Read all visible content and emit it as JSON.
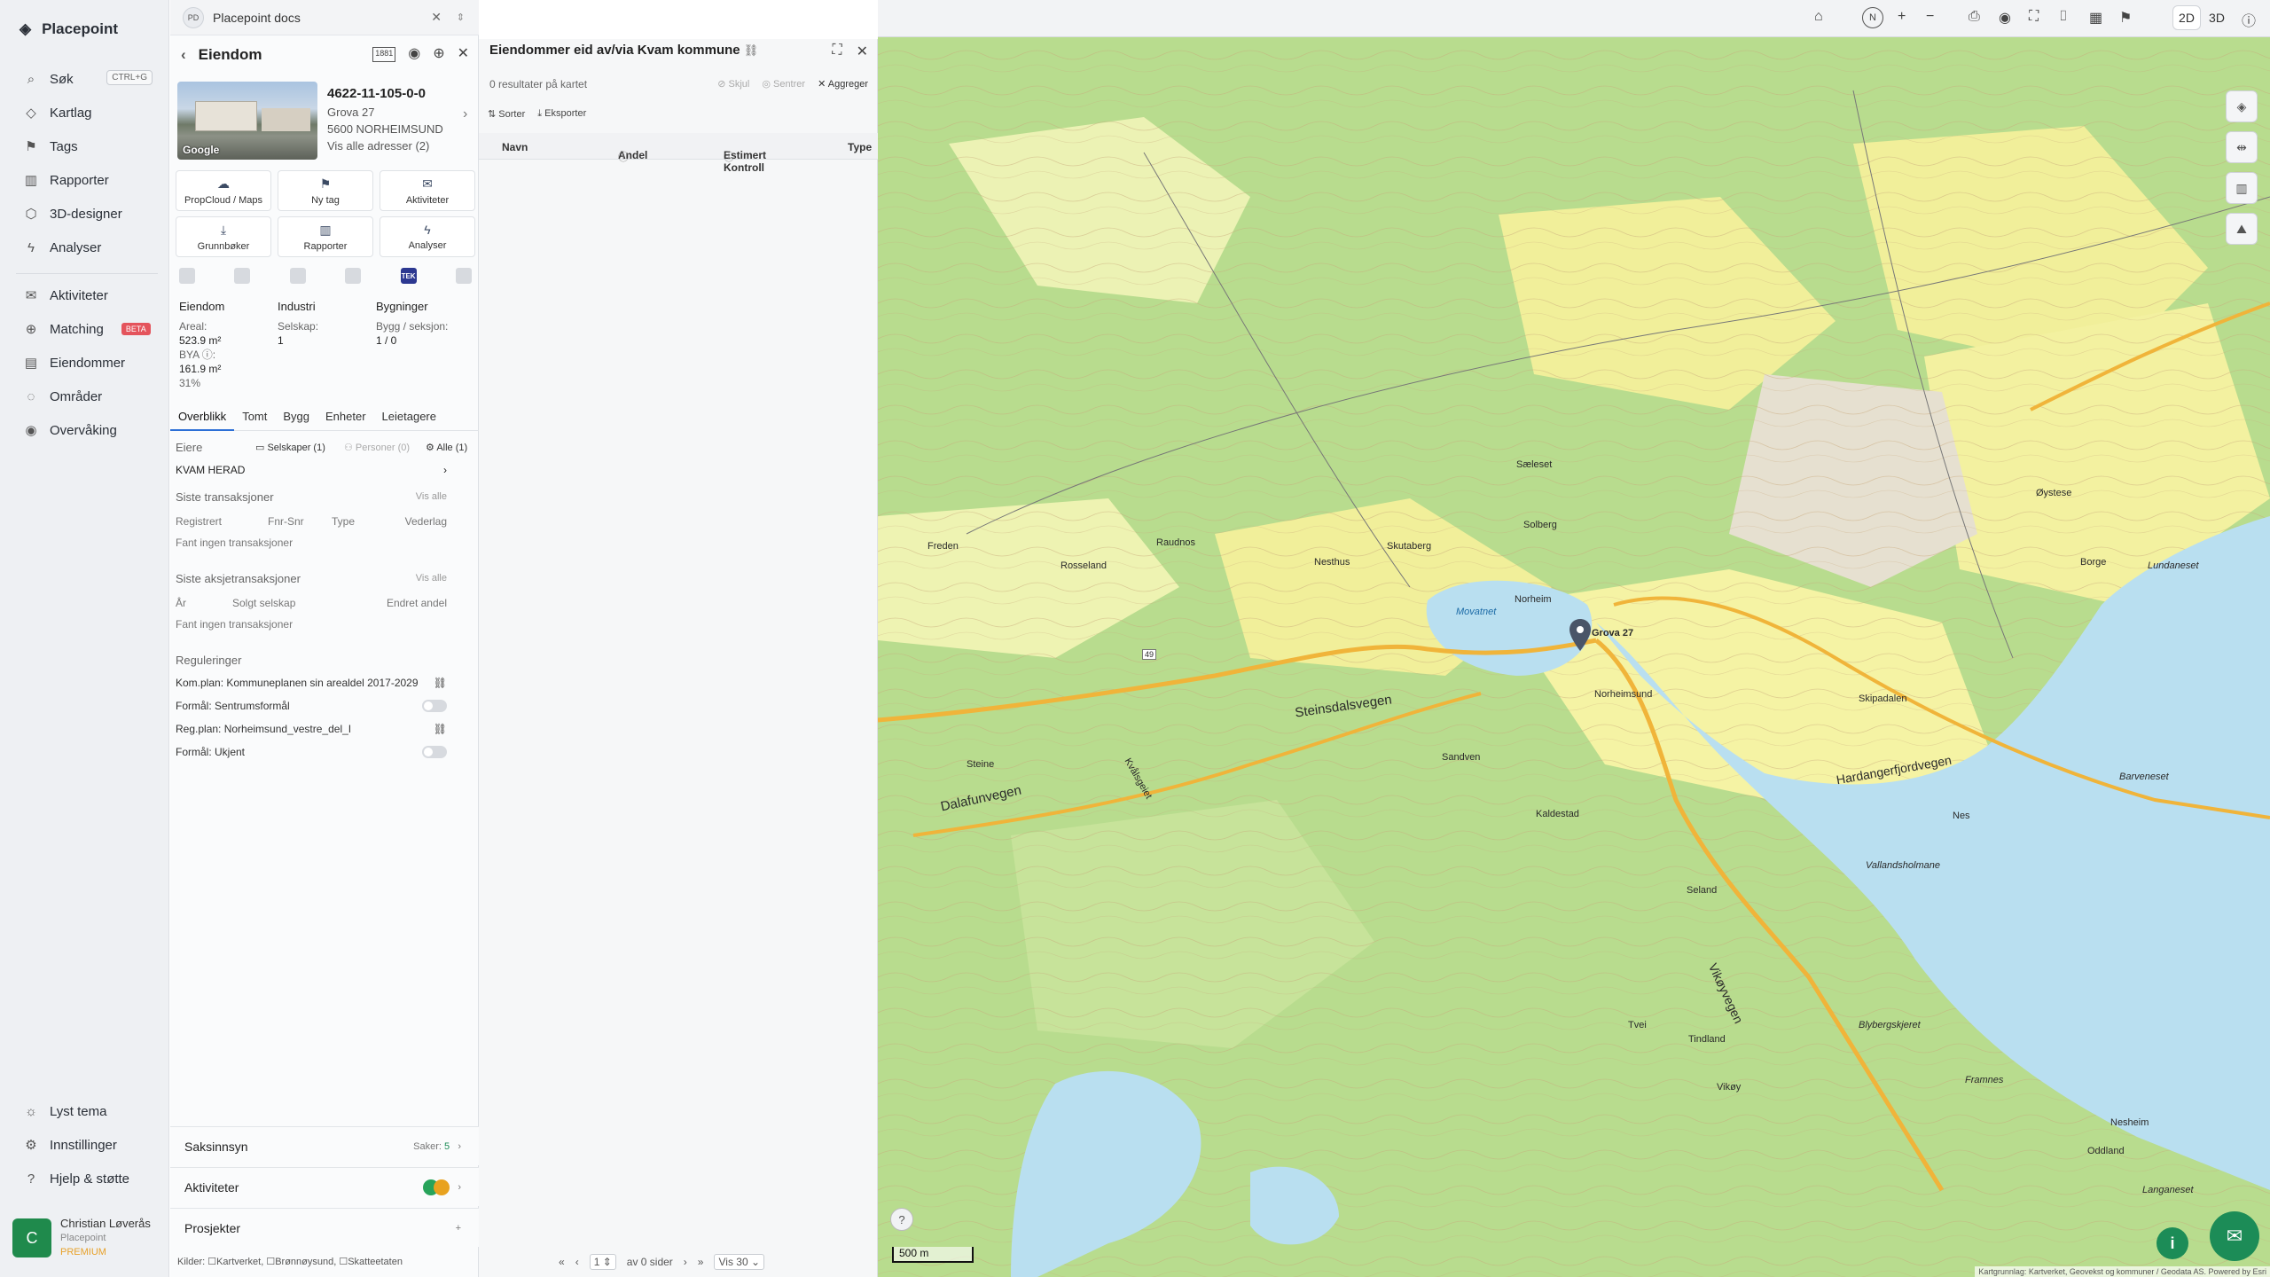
{
  "nav": {
    "brand": "Placepoint",
    "search": "Søk",
    "shortcut": "CTRL+G",
    "items1": [
      "Kartlag",
      "Tags",
      "Rapporter",
      "3D-designer",
      "Analyser"
    ],
    "items2": [
      "Aktiviteter",
      "Matching",
      "Eiendommer",
      "Områder",
      "Overvåking"
    ],
    "beta": "BETA",
    "bottom": [
      "Lyst tema",
      "Innstillinger",
      "Hjelp & støtte"
    ],
    "user": {
      "initial": "C",
      "name": "Christian Løverås",
      "org": "Placepoint",
      "plan": "PREMIUM"
    }
  },
  "docbar": {
    "badge": "PD",
    "title": "Placepoint docs"
  },
  "property": {
    "header": "Eiendom",
    "gnr": "4622-11-105-0-0",
    "address": "Grova 27",
    "postal": "5600 NORHEIMSUND",
    "all_addresses": "Vis alle adresser (2)",
    "google": "Google",
    "badge_1881": "1881"
  },
  "tiles": [
    "PropCloud / Maps",
    "Ny tag",
    "Aktiviteter",
    "Grunnbøker",
    "Rapporter",
    "Analyser"
  ],
  "tek": "TEK",
  "stats": {
    "c1h": "Eiendom",
    "c1l1": "Areal:",
    "c1v1": "523.9 m²",
    "c1l2": "BYA ⓘ:",
    "c1v2": "161.9 m²",
    "c1v3": "31%",
    "c2h": "Industri",
    "c2l1": "Selskap:",
    "c2v1": "1",
    "c3h": "Bygninger",
    "c3l1": "Bygg / seksjon:",
    "c3v1": "1 / 0"
  },
  "tabs": [
    "Overblikk",
    "Tomt",
    "Bygg",
    "Enheter",
    "Leietagere"
  ],
  "owners": {
    "label": "Eiere",
    "companies": "Selskaper (1)",
    "persons": "Personer (0)",
    "all": "Alle (1)",
    "owner": "KVAM HERAD"
  },
  "trans": {
    "title": "Siste transaksjoner",
    "vis": "Vis alle",
    "cols": [
      "Registrert",
      "Fnr-Snr",
      "Type",
      "Vederlag"
    ],
    "empty": "Fant ingen transaksjoner"
  },
  "share": {
    "title": "Siste aksjetransaksjoner",
    "vis": "Vis alle",
    "cols": [
      "År",
      "Solgt selskap",
      "Endret andel"
    ],
    "empty": "Fant ingen transaksjoner"
  },
  "reg": {
    "title": "Reguleringer",
    "kom": "Kom.plan: Kommuneplanen sin arealdel 2017-2029",
    "f1": "Formål: Sentrumsformål",
    "reg": "Reg.plan: Norheimsund_vestre_del_I",
    "f2": "Formål: Ukjent"
  },
  "bottom": {
    "saks": "Saksinnsyn",
    "saker": "Saker:",
    "saker_n": "5",
    "akt": "Aktiviteter",
    "prosj": "Prosjekter",
    "kilder": "Kilder: ☐Kartverket, ☐Brønnøysund, ☐Skatteetaten"
  },
  "list": {
    "title": "Eiendommer eid av/via Kvam kommune",
    "results": "0 resultater på kartet",
    "hide": "Skjul",
    "center": "Sentrer",
    "agg": "Aggreger",
    "sort": "Sorter",
    "export": "Eksporter",
    "cols": [
      "Navn",
      "Andel",
      "Estimert Kontroll",
      "Type"
    ],
    "page": "1",
    "of": "av 0 sider",
    "show": "Vis 30"
  },
  "map": {
    "mode2d": "2D",
    "mode3d": "3D",
    "scale": "500 m",
    "attr": "Kartgrunnlag: Kartverket, Geovekst og kommuner / Geodata AS. Powered by Esri",
    "labels": [
      "Steinsdalsvegen",
      "Norheimsund",
      "Movatnet",
      "Norheim",
      "Vikøyvegen",
      "Hardangerfjordvegen",
      "Dalafunvegen",
      "Steine",
      "Sandven",
      "Kaldestad",
      "Seland",
      "Tvei",
      "Tindland",
      "Vikøy",
      "Øystese",
      "Lundaneset",
      "Barveneset",
      "Vallandsholmane",
      "Blyberg­skjeret",
      "Framnes",
      "Nesheim",
      "Oddland",
      "Langaneset",
      "Kvålsgeiet",
      "Skutaberg",
      "Solberg",
      "Sæleset",
      "Nesthus",
      "Rosseland",
      "Raudnos",
      "Freden",
      "Nes",
      "Borge",
      "Skipadalen",
      "Grova 27"
    ],
    "road": "49"
  },
  "colors": {
    "accent": "#2c6fd6",
    "green": "#1c8c57",
    "water": "#b9dff0",
    "forest": "#b5d98a",
    "field": "#f3f1a0"
  }
}
